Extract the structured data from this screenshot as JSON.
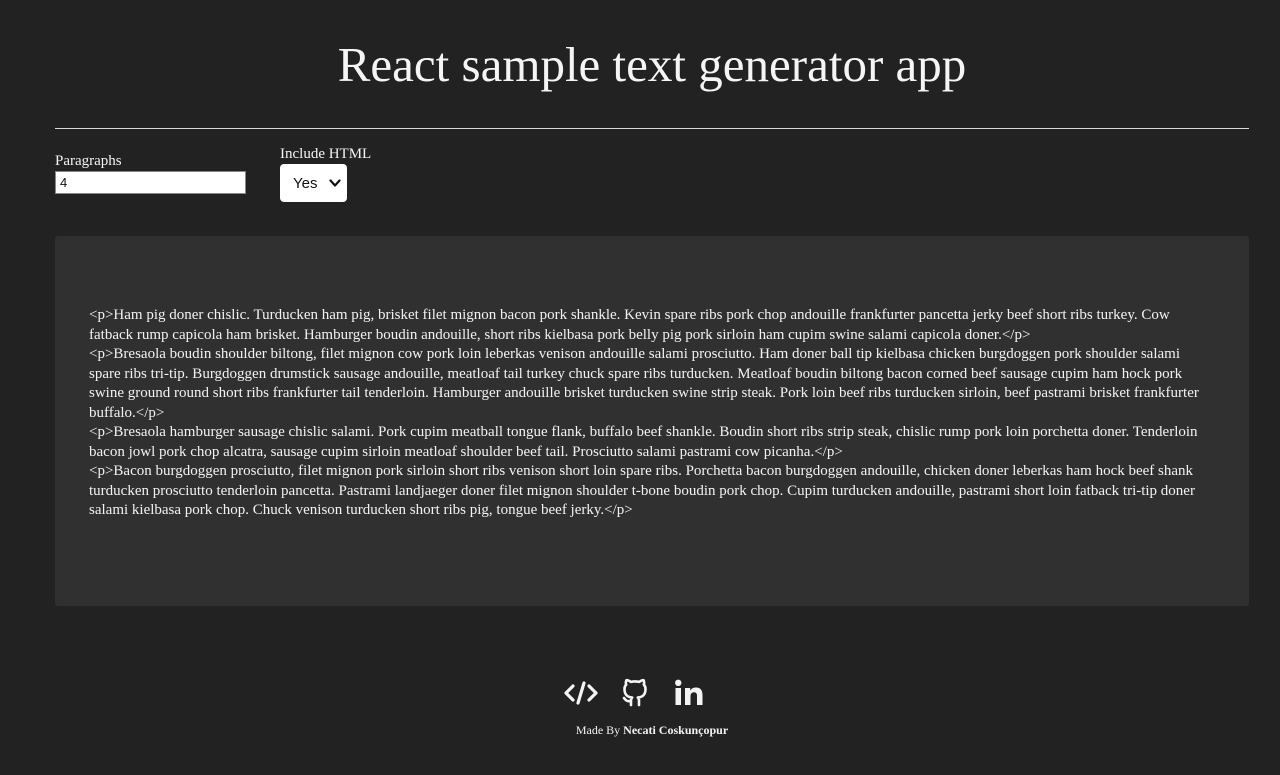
{
  "header": {
    "title": "React sample text generator app"
  },
  "controls": {
    "paragraphs_label": "Paragraphs",
    "paragraphs_value": "4",
    "include_html_label": "Include HTML",
    "include_html_value": "Yes"
  },
  "output": {
    "paragraphs": [
      "<p>Ham pig doner chislic. Turducken ham pig, brisket filet mignon bacon pork shankle. Kevin spare ribs pork chop andouille frankfurter pancetta jerky beef short ribs turkey. Cow fatback rump capicola ham brisket. Hamburger boudin andouille, short ribs kielbasa pork belly pig pork sirloin ham cupim swine salami capicola doner.</p>",
      "<p>Bresaola boudin shoulder biltong, filet mignon cow pork loin leberkas venison andouille salami prosciutto. Ham doner ball tip kielbasa chicken burgdoggen pork shoulder salami spare ribs tri-tip. Burgdoggen drumstick sausage andouille, meatloaf tail turkey chuck spare ribs turducken. Meatloaf boudin biltong bacon corned beef sausage cupim ham hock pork swine ground round short ribs frankfurter tail tenderloin. Hamburger andouille brisket turducken swine strip steak. Pork loin beef ribs turducken sirloin, beef pastrami brisket frankfurter buffalo.</p>",
      "<p>Bresaola hamburger sausage chislic salami. Pork cupim meatball tongue flank, buffalo beef shankle. Boudin short ribs strip steak, chislic rump pork loin porchetta doner. Tenderloin bacon jowl pork chop alcatra, sausage cupim sirloin meatloaf shoulder beef tail. Prosciutto salami pastrami cow picanha.</p>",
      "<p>Bacon burgdoggen prosciutto, filet mignon pork sirloin short ribs venison short loin spare ribs. Porchetta bacon burgdoggen andouille, chicken doner leberkas ham hock beef shank turducken prosciutto tenderloin pancetta. Pastrami landjaeger doner filet mignon shoulder t-bone boudin pork chop. Cupim turducken andouille, pastrami short loin fatback tri-tip doner salami kielbasa pork chop. Chuck venison turducken short ribs pig, tongue beef jerky.</p>"
    ]
  },
  "footer": {
    "icons": [
      "code-icon",
      "github-icon",
      "linkedin-icon"
    ],
    "credit_prefix": "Made By",
    "credit_name": "Necati Coskunçopur"
  },
  "colors": {
    "background": "#222222",
    "panel": "#303030",
    "text": "#f4f4f4"
  }
}
